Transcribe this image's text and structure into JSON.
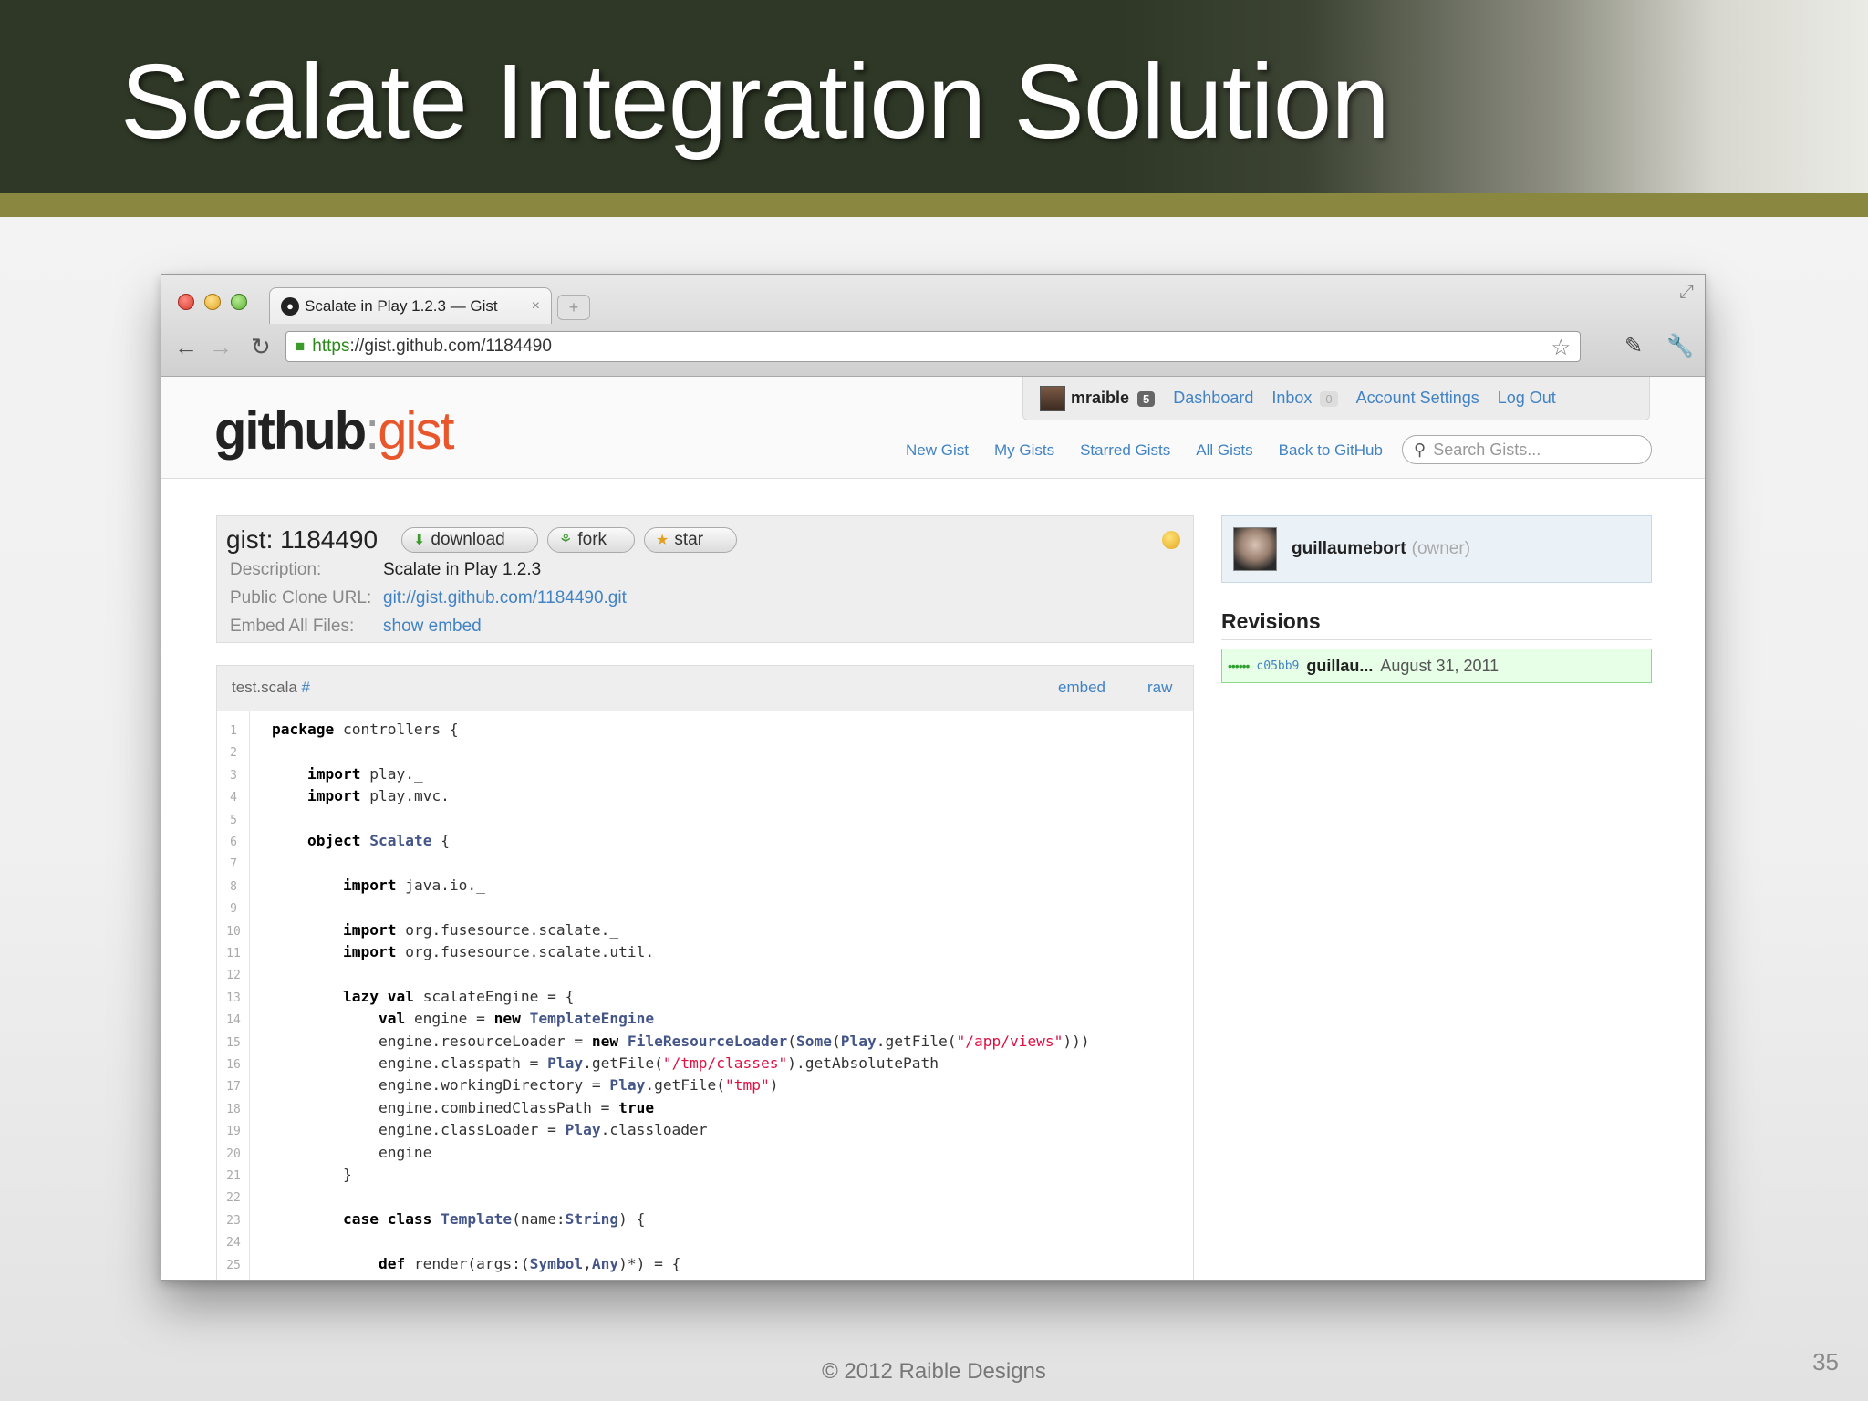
{
  "slide": {
    "title": "Scalate Integration Solution",
    "footer": "© 2012 Raible Designs",
    "page_number": "35"
  },
  "browser": {
    "tab_title": "Scalate in Play 1.2.3 — Gist",
    "tab_close": "×",
    "new_tab": "+",
    "url_scheme": "https",
    "url_rest": "://gist.github.com/1184490",
    "icons": {
      "back": "←",
      "forward": "→",
      "reload": "↻",
      "lock": "🔒",
      "bookmark_star": "☆",
      "extension": "✎",
      "wrench": "🔧",
      "resize": "⤢"
    }
  },
  "github": {
    "logo_main": "github",
    "logo_colon": ":",
    "logo_gist": "gist",
    "user": {
      "name": "mraible",
      "notifications": "5",
      "links": {
        "dashboard": "Dashboard",
        "inbox": "Inbox",
        "inbox_count": "0",
        "account_settings": "Account Settings",
        "logout": "Log Out"
      }
    },
    "subnav": [
      "New Gist",
      "My Gists",
      "Starred Gists",
      "All Gists",
      "Back to GitHub"
    ],
    "search": {
      "placeholder": "Search Gists..."
    }
  },
  "gist": {
    "title": "gist: 1184490",
    "buttons": {
      "download": "download",
      "fork": "fork",
      "star": "star"
    },
    "meta": {
      "description_label": "Description:",
      "description_value": "Scalate in Play 1.2.3",
      "clone_label": "Public Clone URL:",
      "clone_value": "git://gist.github.com/1184490.git",
      "embed_label": "Embed All Files:",
      "embed_value": "show embed"
    },
    "file": {
      "name": "test.scala",
      "hash": "#",
      "embed": "embed",
      "raw": "raw"
    },
    "owner": {
      "name": "guillaumebort",
      "role": "(owner)"
    },
    "revisions": {
      "title": "Revisions",
      "items": [
        {
          "dots": "••••••",
          "sha": "c05bb9",
          "author": "guillau...",
          "date": "August 31, 2011"
        }
      ]
    }
  },
  "code_lines": [
    [
      [
        "kw",
        "package"
      ],
      [
        "",
        "controllers {"
      ]
    ],
    [],
    [
      [
        "",
        "    "
      ],
      [
        "kw",
        "import"
      ],
      [
        "",
        "play._"
      ]
    ],
    [
      [
        "",
        "    "
      ],
      [
        "kw",
        "import"
      ],
      [
        "",
        "play.mvc._"
      ]
    ],
    [],
    [
      [
        "",
        "    "
      ],
      [
        "kw",
        "object"
      ],
      [
        "ty",
        "Scalate"
      ],
      [
        "",
        " {"
      ]
    ],
    [],
    [
      [
        "",
        "        "
      ],
      [
        "kw",
        "import"
      ],
      [
        "",
        "java.io._"
      ]
    ],
    [],
    [
      [
        "",
        "        "
      ],
      [
        "kw",
        "import"
      ],
      [
        "",
        "org.fusesource.scalate._"
      ]
    ],
    [
      [
        "",
        "        "
      ],
      [
        "kw",
        "import"
      ],
      [
        "",
        "org.fusesource.scalate.util._"
      ]
    ],
    [],
    [
      [
        "",
        "        "
      ],
      [
        "kw",
        "lazy val"
      ],
      [
        "",
        "scalateEngine = {"
      ]
    ],
    [
      [
        "",
        "            "
      ],
      [
        "kw",
        "val"
      ],
      [
        "",
        "engine = "
      ],
      [
        "kw",
        "new"
      ],
      [
        "ty",
        "TemplateEngine"
      ]
    ],
    [
      [
        "",
        "            engine.resourceLoader = "
      ],
      [
        "kw",
        "new"
      ],
      [
        "ty",
        "FileResourceLoader"
      ],
      [
        "",
        "("
      ],
      [
        "ty",
        "Some"
      ],
      [
        "",
        "("
      ],
      [
        "ty",
        "Play"
      ],
      [
        "",
        ".getFile("
      ],
      [
        "st",
        "\"/app/views\""
      ],
      [
        "",
        "))) "
      ]
    ],
    [
      [
        "",
        "            engine.classpath = "
      ],
      [
        "ty",
        "Play"
      ],
      [
        "",
        ".getFile("
      ],
      [
        "st",
        "\"/tmp/classes\""
      ],
      [
        "",
        ").getAbsolutePath"
      ]
    ],
    [
      [
        "",
        "            engine.workingDirectory = "
      ],
      [
        "ty",
        "Play"
      ],
      [
        "",
        ".getFile("
      ],
      [
        "st",
        "\"tmp\""
      ],
      [
        "",
        ")"
      ]
    ],
    [
      [
        "",
        "            engine.combinedClassPath = "
      ],
      [
        "kw",
        "true"
      ]
    ],
    [
      [
        "",
        "            engine.classLoader = "
      ],
      [
        "ty",
        "Play"
      ],
      [
        "",
        ".classloader"
      ]
    ],
    [
      [
        "",
        "            engine"
      ]
    ],
    [
      [
        "",
        "        }"
      ]
    ],
    [],
    [
      [
        "",
        "        "
      ],
      [
        "kw",
        "case class"
      ],
      [
        "ty",
        "Template"
      ],
      [
        "",
        "(name:"
      ],
      [
        "ty",
        "String"
      ],
      [
        "",
        ") {"
      ]
    ],
    [],
    [
      [
        "",
        "            "
      ],
      [
        "kw",
        "def"
      ],
      [
        "",
        "render(args:("
      ],
      [
        "ty",
        "Symbol"
      ],
      [
        "",
        ","
      ],
      [
        "ty",
        "Any"
      ],
      [
        "",
        ")*) = {"
      ]
    ]
  ]
}
